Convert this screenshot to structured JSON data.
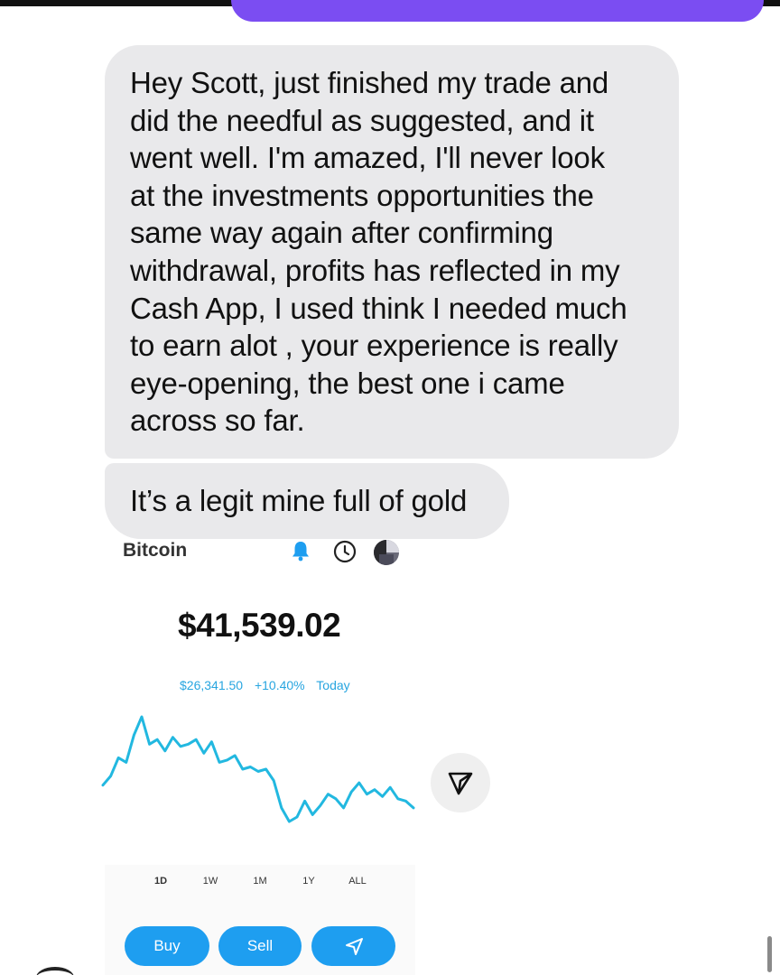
{
  "messages": [
    {
      "text": "Hey Scott, just finished my trade and\ndid the needful as suggested, and it\nwent well.  I'm amazed, I'll never look\nat the investments opportunities the\nsame way again after confirming\nwithdrawal, profits has reflected in my\nCash App, I used think I needed much\nto earn alot , your experience is really\neye-opening, the best one i came\nacross so far."
    },
    {
      "text": "It’s a legit mine full of gold"
    }
  ],
  "embedded_screenshot": {
    "asset_name": "Bitcoin",
    "price": "$41,539.02",
    "change_amount": "$26,341.50",
    "change_percent": "+10.40%",
    "change_period": "Today",
    "range_tabs": [
      "1D",
      "1W",
      "1M",
      "1Y",
      "ALL"
    ],
    "selected_range": "1D",
    "buttons": {
      "buy": "Buy",
      "sell": "Sell"
    },
    "accent_color": "#1e9ef0",
    "chart_line_color": "#22b8e0"
  },
  "chart_data": {
    "type": "line",
    "title": "",
    "xlabel": "",
    "ylabel": "",
    "series": [
      {
        "values": [
          40,
          44,
          52,
          50,
          62,
          70,
          58,
          60,
          55,
          61,
          57,
          58,
          60,
          54,
          59,
          50,
          51,
          53,
          47,
          48,
          46,
          47,
          42,
          30,
          24,
          26,
          33,
          27,
          31,
          36,
          34,
          30,
          37,
          41,
          36,
          38,
          35,
          39,
          34,
          33,
          30
        ]
      }
    ]
  }
}
